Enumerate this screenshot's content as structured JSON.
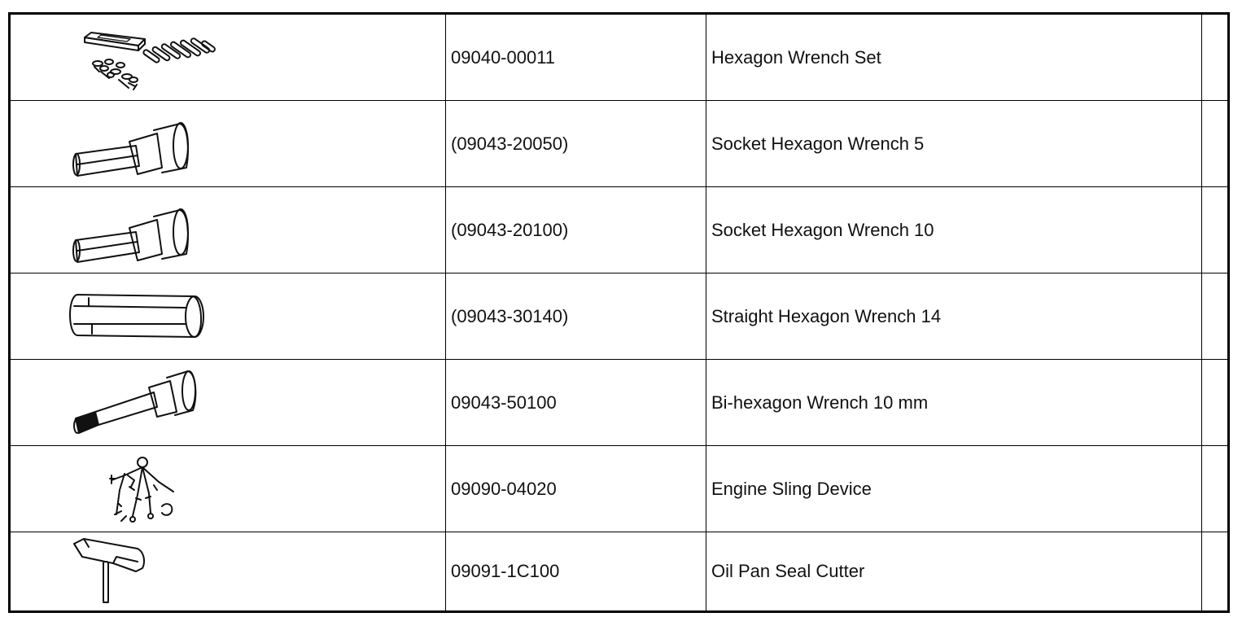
{
  "table": {
    "rows": [
      {
        "illustration": "hexagon-wrench-set-icon",
        "part_number": "09040-00011",
        "name": "Hexagon Wrench Set",
        "note": ""
      },
      {
        "illustration": "socket-hexagon-wrench-icon",
        "part_number": "(09043-20050)",
        "name": "Socket Hexagon Wrench 5",
        "note": ""
      },
      {
        "illustration": "socket-hexagon-wrench-icon",
        "part_number": "(09043-20100)",
        "name": "Socket Hexagon Wrench 10",
        "note": ""
      },
      {
        "illustration": "straight-hexagon-wrench-icon",
        "part_number": "(09043-30140)",
        "name": "Straight Hexagon Wrench 14",
        "note": ""
      },
      {
        "illustration": "bi-hexagon-wrench-icon",
        "part_number": "09043-50100",
        "name": "Bi-hexagon Wrench 10 mm",
        "note": ""
      },
      {
        "illustration": "engine-sling-device-icon",
        "part_number": "09090-04020",
        "name": "Engine Sling Device",
        "note": ""
      },
      {
        "illustration": "oil-pan-seal-cutter-icon",
        "part_number": "09091-1C100",
        "name": "Oil Pan Seal Cutter",
        "note": ""
      }
    ]
  }
}
